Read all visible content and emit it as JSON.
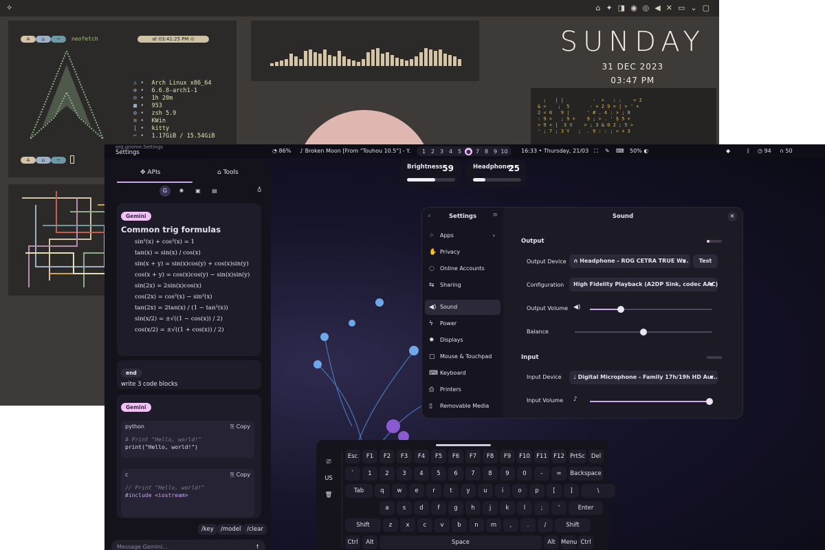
{
  "back": {
    "bar": {
      "tray_icons": [
        "home-icon",
        "flame-icon",
        "shield-icon",
        "record-icon",
        "eye-icon",
        "volume-icon",
        "mic-icon",
        "monitor-icon",
        "chevron-icon",
        "window-icon"
      ]
    },
    "neofetch": {
      "chips": [
        "A",
        "⌂",
        "~"
      ],
      "title": "neofetch",
      "time_chip": "at 03:41:25 PM ⊙",
      "lines": [
        {
          "label": "♙",
          "value": "Arch Linux x86_64"
        },
        {
          "label": "⊕",
          "value": "6.6.8-arch1-1"
        },
        {
          "label": "⊘",
          "value": "1h 20m"
        },
        {
          "label": "■",
          "value": "953"
        },
        {
          "label": "⚙",
          "value": "zsh 5.9"
        },
        {
          "label": "≋",
          "value": "KWin"
        },
        {
          "label": "⌊",
          "value": "kitty"
        },
        {
          "label": "⌐",
          "value": "1.17GiB / 15.54GiB"
        }
      ]
    },
    "clock": {
      "day": "SUNDAY",
      "date": "31 DEC 2023",
      "time": "03:47 PM"
    },
    "visualizer": [
      2,
      3,
      4,
      5,
      9,
      7,
      5,
      11,
      12,
      10,
      9,
      12,
      8,
      7,
      11,
      7,
      5,
      4,
      3,
      5,
      10,
      12,
      13,
      9,
      10,
      8,
      6,
      5,
      4,
      5,
      7,
      10,
      13,
      12,
      11,
      12,
      9,
      8,
      7,
      5
    ]
  },
  "front": {
    "topbar": {
      "app_id": "org.gnome.Settings",
      "app_name": "Settings",
      "battery": "86%",
      "media": "Broken Moon [From \"Touhou 10.5\"] - Y...",
      "workspaces": [
        "1",
        "2",
        "3",
        "4",
        "5",
        "6",
        "7",
        "8",
        "9",
        "10"
      ],
      "active_workspace": "6",
      "clock": "16:33 • Thursday, 21/03",
      "volume": "50%",
      "temp": "94",
      "headphones_level": "50"
    },
    "osd": {
      "brightness": {
        "label": "Brightness",
        "value": "59",
        "level": 0.59
      },
      "headphones": {
        "label": "Headphones",
        "value": "25",
        "level": 0.25
      }
    },
    "sidebar": {
      "tabs": [
        "APIs",
        "Tools"
      ],
      "gemini_badge": "Gemini",
      "answer_title": "Common trig formulas",
      "formulas": [
        "sin²(x) + cos²(x) = 1",
        "tan(x) = sin(x) / cos(x)",
        "sin(x + y) = sin(x)cos(y) + cos(x)sin(y)",
        "cos(x + y) = cos(x)cos(y) − sin(x)sin(y)",
        "sin(2x) = 2sin(x)cos(x)",
        "cos(2x) = cos²(x) − sin²(x)",
        "tan(2x) = 2tan(x) / (1 − tan²(x))",
        "sin(x/2) = ±√((1 − cos(x)) / 2)",
        "cos(x/2) = ±√((1 + cos(x)) / 2)"
      ],
      "user_badge": "end",
      "user_message": "write 3 code blocks",
      "gemini_badge_2": "Gemini",
      "code1": {
        "lang": "python",
        "copy": "Copy",
        "comment": "# Print \"Hello, world!\"",
        "line": "print(\"Hello, world!\")"
      },
      "code2": {
        "lang": "c",
        "copy": "Copy",
        "comment": "// Print \"Hello, world!\"",
        "line": "#include <iostream>"
      },
      "commands": [
        "/key",
        "/model",
        "/clear"
      ],
      "input_placeholder": "Message Gemini..."
    },
    "settings": {
      "sidebar_title": "Settings",
      "main_title": "Sound",
      "nav": [
        "Apps",
        "Privacy",
        "Online Accounts",
        "Sharing",
        "Sound",
        "Power",
        "Displays",
        "Mouse & Touchpad",
        "Keyboard",
        "Printers",
        "Removable Media"
      ],
      "output_section": "Output",
      "output_device_label": "Output Device",
      "output_device": "Headphone - ROG CETRA TRUE W...",
      "test_button": "Test",
      "configuration_label": "Configuration",
      "configuration": "High Fidelity Playback (A2DP Sink, codec AAC)",
      "output_volume_label": "Output Volume",
      "output_volume_level": 0.25,
      "balance_label": "Balance",
      "balance_level": 0.5,
      "input_section": "Input",
      "input_device_label": "Input Device",
      "input_device": "Digital Microphone - Family 17h/19h HD Au...",
      "input_volume_label": "Input Volume",
      "input_volume_level": 1.0
    },
    "keyboard": {
      "side": [
        "⎚",
        "US",
        "🗑"
      ],
      "rows": [
        [
          "Esc",
          "F1",
          "F2",
          "F3",
          "F4",
          "F5",
          "F6",
          "F7",
          "F8",
          "F9",
          "F10",
          "F11",
          "F12",
          "PrtSc",
          "Del"
        ],
        [
          "`",
          "1",
          "2",
          "3",
          "4",
          "5",
          "6",
          "7",
          "8",
          "9",
          "0",
          "-",
          "=",
          "Backspace"
        ],
        [
          "Tab",
          "q",
          "w",
          "e",
          "r",
          "t",
          "y",
          "u",
          "i",
          "o",
          "p",
          "[",
          "]",
          "\\"
        ],
        [
          "a",
          "s",
          "d",
          "f",
          "g",
          "h",
          "j",
          "k",
          "l",
          ";",
          "'",
          "Enter"
        ],
        [
          "Shift",
          "z",
          "x",
          "c",
          "v",
          "b",
          "n",
          "m",
          ",",
          ".",
          "/",
          "Shift"
        ],
        [
          "Ctrl",
          "Alt",
          "Space",
          "Alt",
          "Menu",
          "Ctrl"
        ]
      ]
    }
  }
}
